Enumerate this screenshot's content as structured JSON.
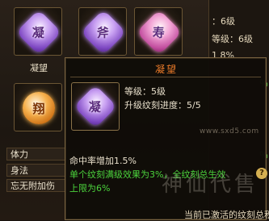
{
  "slots": [
    {
      "label": "凝望",
      "glyph": "凝"
    },
    {
      "label": "",
      "glyph": "斧"
    },
    {
      "label": "",
      "glyph": "寿"
    },
    {
      "label": "",
      "glyph": "翔"
    }
  ],
  "right_panel": {
    "row1": "：6级",
    "row2": "等级：6级",
    "row3": "1 8%",
    "row4": "％",
    "row5": "％"
  },
  "stats": [
    "体力",
    "身法",
    "忘无附加伤"
  ],
  "tooltip": {
    "title": "凝望",
    "level": "等级：5级",
    "progress": "升级纹刻进度：5/5",
    "effect": "命中率增加1.5%",
    "note_line1": "单个纹刻满级效果为3%，全纹刻总生效",
    "note_line2": "上限为6%"
  },
  "watermark": "www.sxd5.com",
  "logo_text": "神仙代售",
  "current_activated": "当前已激活的纹刻总积"
}
